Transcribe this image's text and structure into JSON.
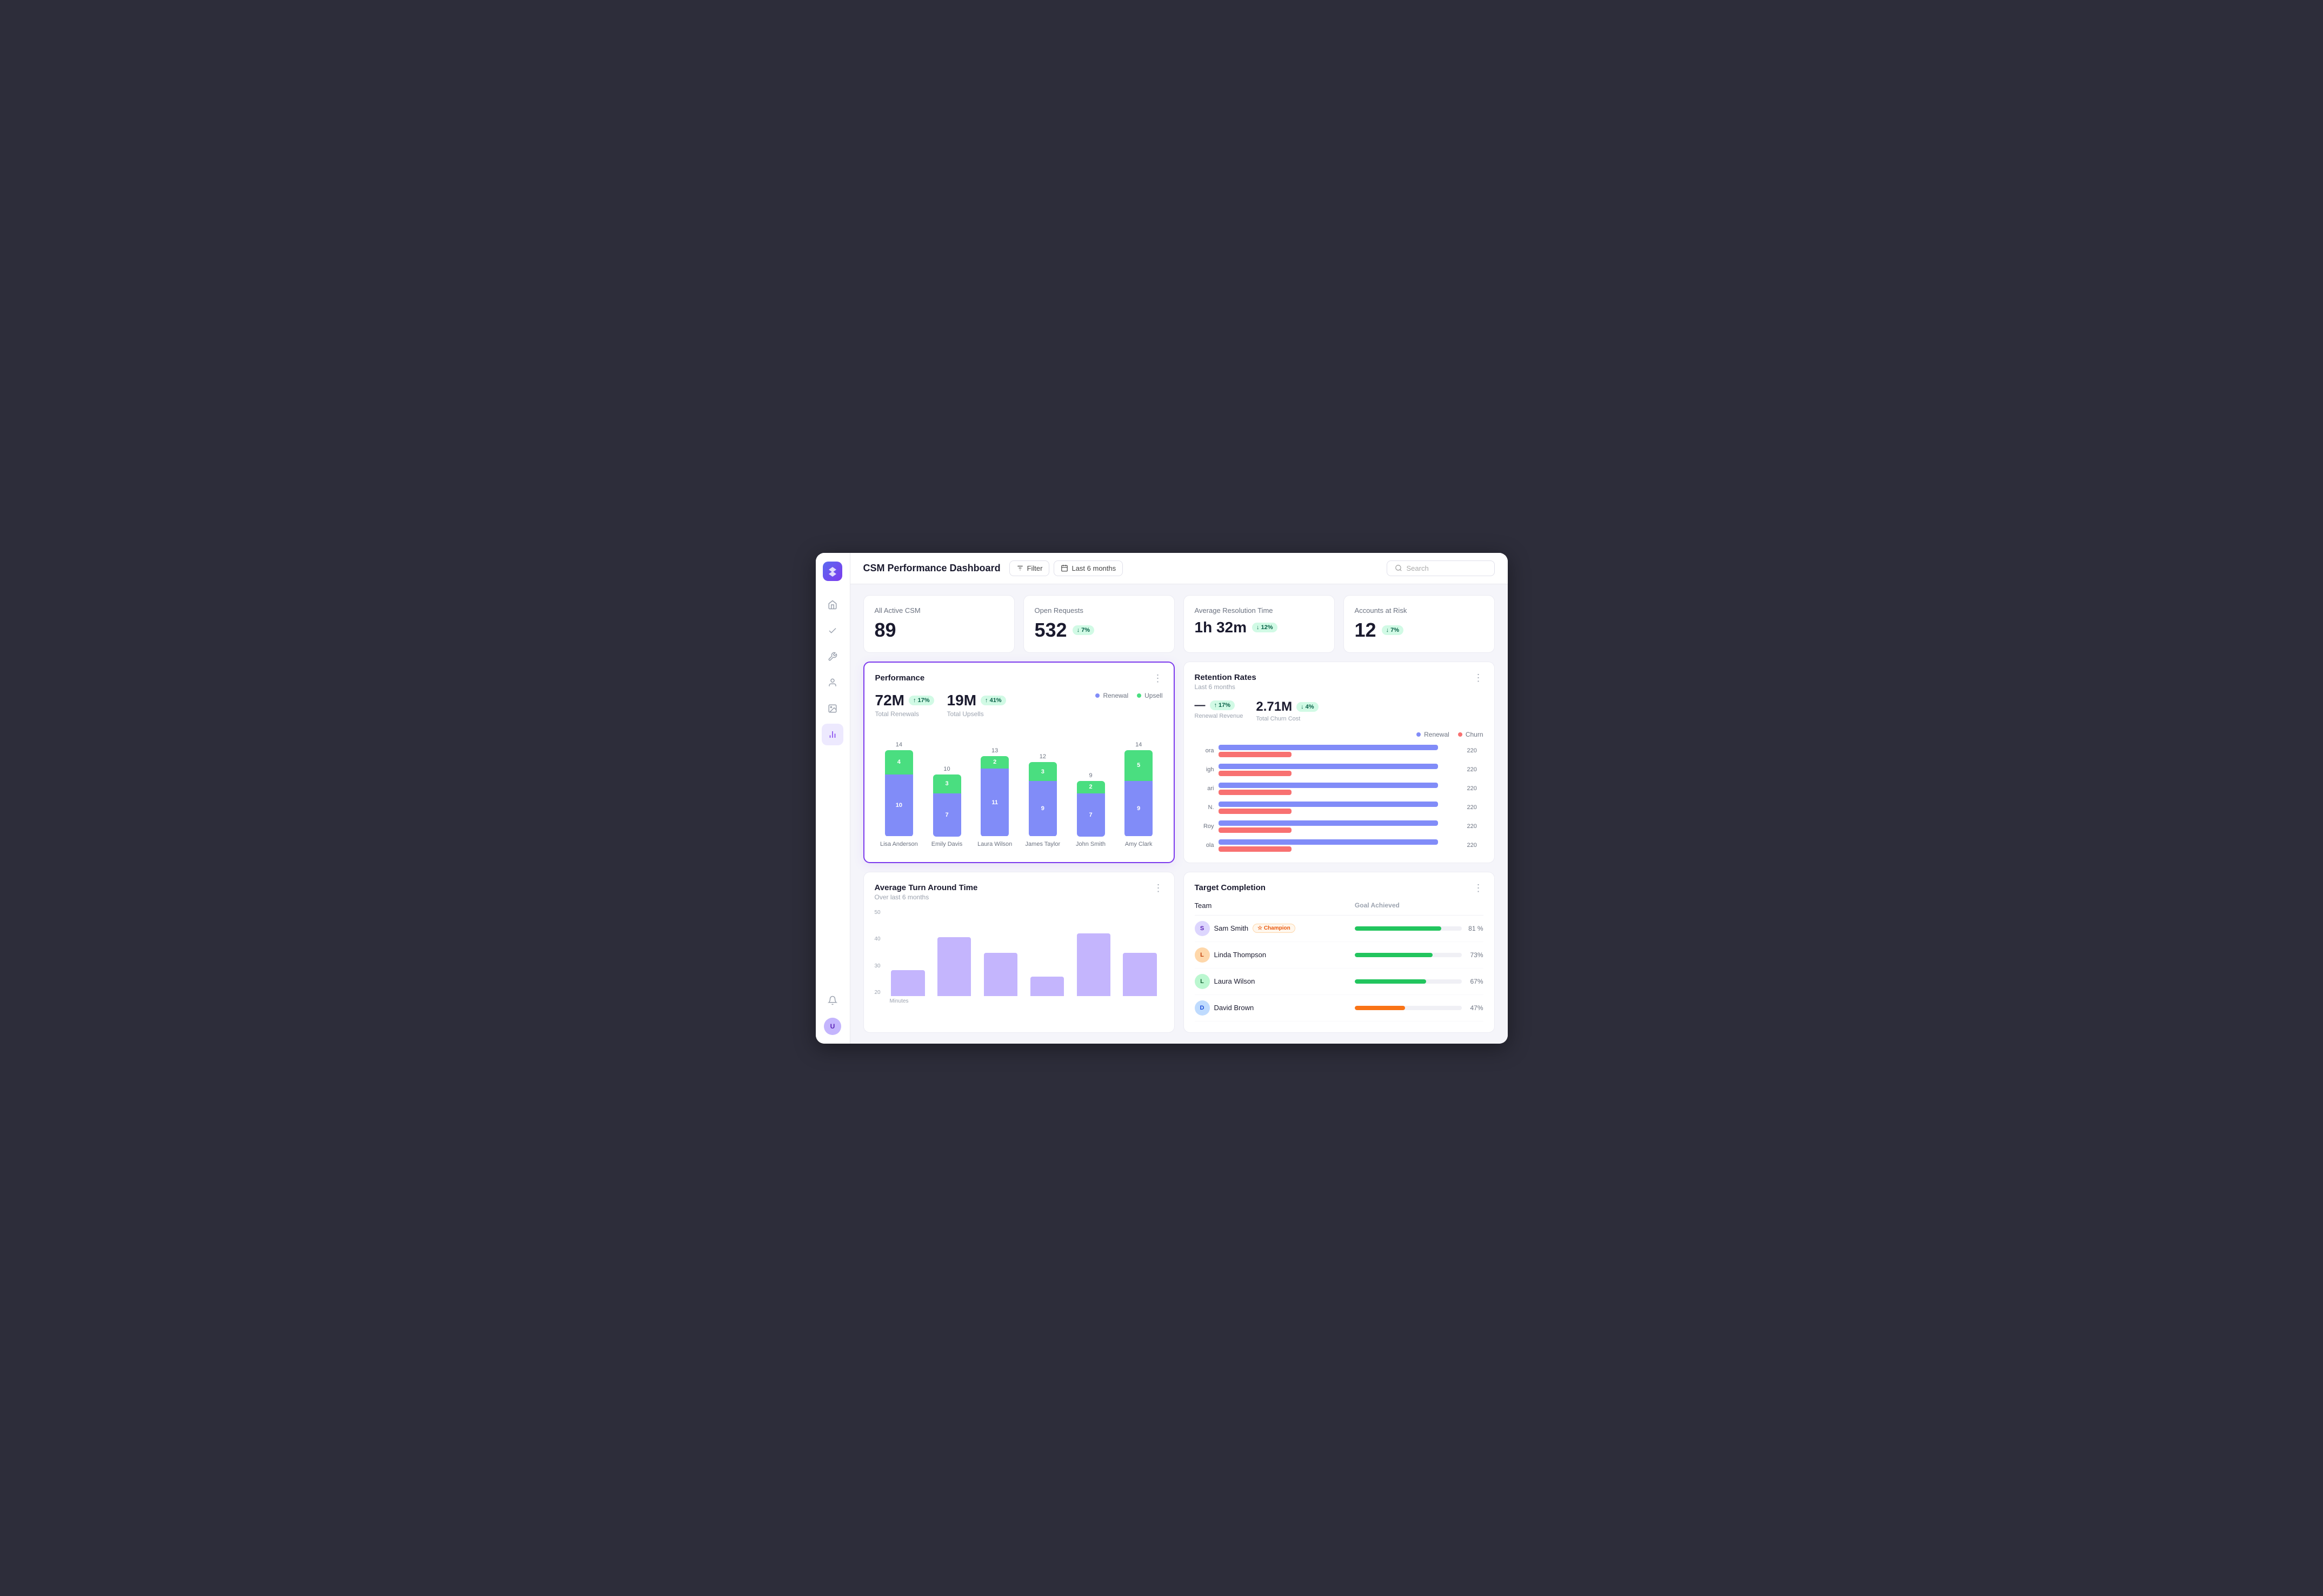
{
  "app": {
    "title": "CSM Performance Dashboard",
    "logo_icon": "diamond"
  },
  "header": {
    "filter_label": "Filter",
    "date_range": "Last 6 months",
    "search_placeholder": "Search"
  },
  "sidebar": {
    "icons": [
      {
        "name": "home-icon",
        "glyph": "⌂",
        "active": false
      },
      {
        "name": "check-icon",
        "glyph": "✓",
        "active": false
      },
      {
        "name": "wrench-icon",
        "glyph": "🔧",
        "active": false
      },
      {
        "name": "person-icon",
        "glyph": "👤",
        "active": false
      },
      {
        "name": "image-icon",
        "glyph": "🖼",
        "active": false
      },
      {
        "name": "chart-icon",
        "glyph": "📊",
        "active": true
      }
    ]
  },
  "stat_cards": [
    {
      "label": "All Active CSM",
      "value": "89",
      "badge": null
    },
    {
      "label": "Open Requests",
      "value": "532",
      "badge": "↓ 7%",
      "badge_type": "green"
    },
    {
      "label": "Average Resolution Time",
      "value": "1h 32m",
      "badge": "↓ 12%",
      "badge_type": "green"
    },
    {
      "label": "Accounts at Risk",
      "value": "12",
      "badge": "↓ 7%",
      "badge_type": "green"
    }
  ],
  "performance": {
    "title": "Performance",
    "total_renewals_value": "72M",
    "total_renewals_label": "Total Renewals",
    "total_renewals_badge": "↑ 17%",
    "total_upsells_value": "19M",
    "total_upsells_label": "Total Upsells",
    "total_upsells_badge": "↑ 41%",
    "legend_renewal": "Renewal",
    "legend_upsell": "Upsell",
    "bars": [
      {
        "name": "Lisa Anderson",
        "renewal": 10,
        "upsell": 4,
        "total": 14
      },
      {
        "name": "Emily Davis",
        "renewal": 7,
        "upsell": 3,
        "total": 10
      },
      {
        "name": "Laura Wilson",
        "renewal": 11,
        "upsell": 2,
        "total": 13
      },
      {
        "name": "James Taylor",
        "renewal": 9,
        "upsell": 3,
        "total": 12
      },
      {
        "name": "John Smith",
        "renewal": 7,
        "upsell": 2,
        "total": 9
      },
      {
        "name": "Amy Clark",
        "renewal": 9,
        "upsell": 5,
        "total": 14
      }
    ]
  },
  "retention_rates": {
    "title": "Retention Rates",
    "subtitle": "Last 6 months",
    "renewal_revenue_value": "—",
    "renewal_revenue_badge": "↑ 17%",
    "renewal_revenue_label": "Renewal Revenue",
    "churn_cost_value": "2.71M",
    "churn_cost_badge": "↓ 4%",
    "churn_cost_label": "Total Churn Cost",
    "legend_renewal": "Renewal",
    "legend_churn": "Churn",
    "rows": [
      {
        "label": "ora",
        "renewal": 220,
        "churn": 220
      },
      {
        "label": "igh",
        "renewal": 220,
        "churn": 220
      },
      {
        "label": "ari",
        "renewal": 220,
        "churn": 220
      },
      {
        "label": "N.",
        "renewal": 220,
        "churn": 220
      },
      {
        "label": "Roy",
        "renewal": 220,
        "churn": 220
      },
      {
        "label": "ola",
        "renewal": 220,
        "churn": 220
      }
    ]
  },
  "turnaround": {
    "title": "Average Turn Around Time",
    "subtitle": "Over last 6 months",
    "y_labels": [
      "50",
      "40",
      "30",
      "20"
    ],
    "bars_height_pct": [
      30,
      68,
      50,
      22,
      72,
      50
    ],
    "x_labels": [
      "",
      "",
      "",
      "",
      "",
      ""
    ]
  },
  "target_completion": {
    "title": "Target Completion",
    "col_team": "Team",
    "col_goal": "Goal Achieved",
    "rows": [
      {
        "name": "Sam Smith",
        "badge": "Champion",
        "pct": 81,
        "pct_label": "81 %",
        "color": "green",
        "avatar_color": "purple"
      },
      {
        "name": "Linda Thompson",
        "badge": null,
        "pct": 73,
        "pct_label": "73%",
        "color": "green",
        "avatar_color": "orange"
      },
      {
        "name": "Laura Wilson",
        "badge": null,
        "pct": 67,
        "pct_label": "67%",
        "color": "green",
        "avatar_color": "green"
      },
      {
        "name": "David Brown",
        "badge": null,
        "pct": 47,
        "pct_label": "47%",
        "color": "orange",
        "avatar_color": "blue"
      }
    ]
  }
}
